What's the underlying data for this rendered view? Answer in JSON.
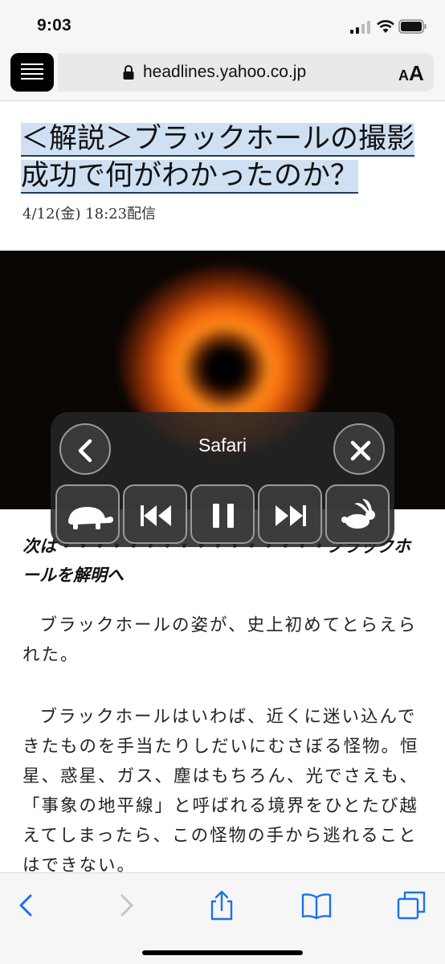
{
  "status_bar": {
    "time": "9:03"
  },
  "url_bar": {
    "url": "headlines.yahoo.co.jp",
    "text_size_label": [
      "A",
      "A"
    ]
  },
  "article": {
    "headline": "＜解説＞ブラックホールの撮影成功で何がわかったのか？",
    "dateline": "4/12(金) 18:23配信",
    "subhead": "次は・・・・・・・・・・・・・・・・ブラックホールを解明へ",
    "paragraphs": [
      "ブラックホールの姿が、史上初めてとらえられた。",
      "ブラックホールはいわば、近くに迷い込んできたものを手当たりしだいにむさぼる怪物。恒星、惑星、ガス、塵はもちろん、光でさえも、「事象の地平線」と呼ばれる境界をひとたび越えてしまったら、この怪物の手から逃れることはできない。"
    ]
  },
  "media_panel": {
    "title": "Safari",
    "controls": [
      "slower-icon",
      "skip-back-icon",
      "pause-icon",
      "skip-forward-icon",
      "faster-icon"
    ]
  },
  "toolbar": {
    "buttons": [
      "back-icon",
      "forward-icon",
      "share-icon",
      "bookmarks-icon",
      "tabs-icon"
    ]
  },
  "colors": {
    "accent": "#1a73e8",
    "highlight": "#cfe0f2",
    "panel": "#262626"
  }
}
